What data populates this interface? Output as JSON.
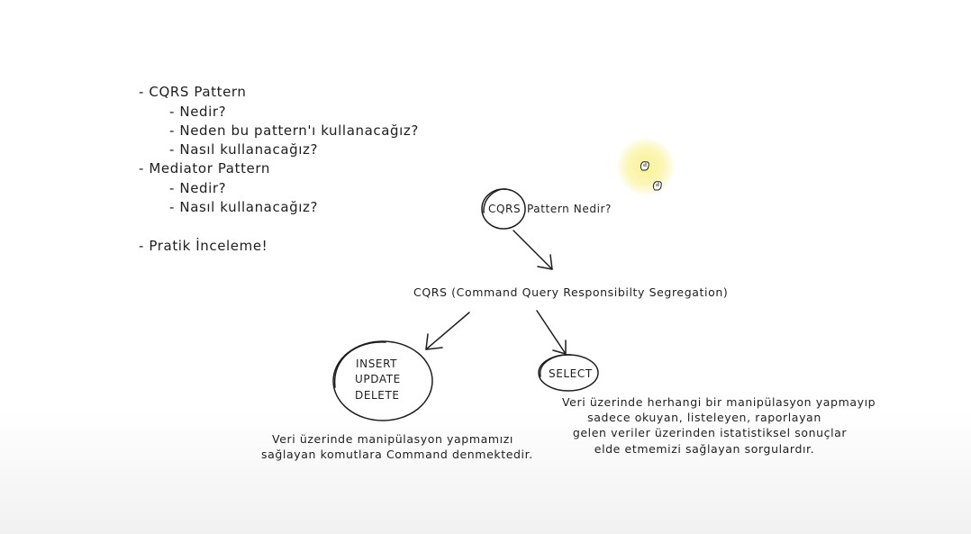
{
  "outline": [
    {
      "text": "- CQRS Pattern",
      "level": 1
    },
    {
      "text": "- Nedir?",
      "level": 2
    },
    {
      "text": "- Neden bu pattern'ı kullanacağız?",
      "level": 2
    },
    {
      "text": "- Nasıl kullanacağız?",
      "level": 2
    },
    {
      "text": "- Mediator Pattern",
      "level": 1
    },
    {
      "text": "- Nedir?",
      "level": 2
    },
    {
      "text": "- Nasıl kullanacağız?",
      "level": 2
    },
    {
      "text": "- Pratik İnceleme!",
      "level": 1
    }
  ],
  "diagram": {
    "cqrs_circle_label": "CQRS",
    "question_label": "Pattern Nedir?",
    "definition_label": "CQRS (Command Query Responsibilty Segregation)",
    "command_circle": {
      "line1": "INSERT",
      "line2": "UPDATE",
      "line3": "DELETE"
    },
    "query_circle_label": "SELECT",
    "command_note": {
      "line1": "Veri üzerinde manipülasyon yapmamızı",
      "line2": "sağlayan komutlara Command denmektedir."
    },
    "query_note": {
      "line1": "Veri üzerinde herhangi bir manipülasyon yapmayıp",
      "line2": "sadece okuyan, listeleyen, raporlayan",
      "line3": "gelen veriler üzerinden istatistiksel sonuçlar",
      "line4": "elde etmemizi sağlayan sorgulardır."
    }
  },
  "icons": {
    "laser": "laser-pointer-glow",
    "cursor1": "hand-cursor-icon",
    "cursor2": "hand-cursor-icon"
  },
  "colors": {
    "ink": "#1e1e1e",
    "laser": "#f8ef8a",
    "background": "#ffffff"
  }
}
